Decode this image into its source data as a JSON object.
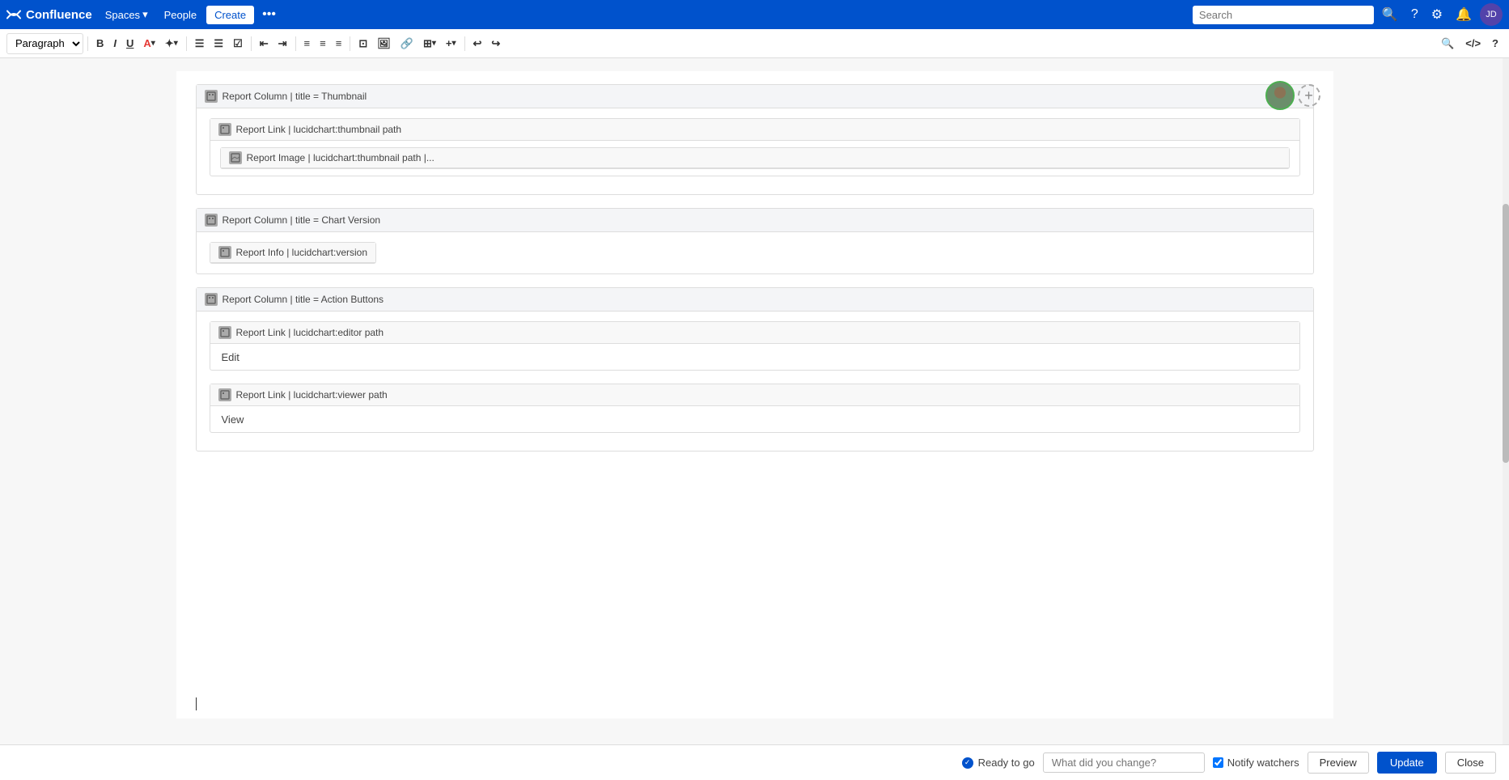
{
  "nav": {
    "logo_text": "Confluence",
    "spaces_label": "Spaces",
    "people_label": "People",
    "create_label": "Create",
    "search_placeholder": "Search",
    "help_icon": "?",
    "settings_icon": "⚙",
    "notifications_icon": "🔔"
  },
  "toolbar": {
    "paragraph_label": "Paragraph",
    "bold_label": "B",
    "italic_label": "I",
    "underline_label": "U",
    "color_label": "A",
    "format_label": "✦",
    "bullet_label": "≡",
    "numbered_label": "≡",
    "task_label": "☑",
    "indent_left_label": "←",
    "indent_right_label": "→",
    "align_left": "≡",
    "align_center": "≡",
    "align_right": "≡",
    "panel_label": "⊡",
    "image_label": "🖼",
    "link_label": "🔗",
    "table_label": "⊞",
    "insert_label": "+",
    "undo_label": "↩",
    "redo_label": "↪",
    "find_label": "🔍",
    "source_label": "</>",
    "help_label": "?"
  },
  "editor": {
    "columns": [
      {
        "id": "col-thumbnail",
        "header": "Report Column | title = Thumbnail",
        "children": [
          {
            "type": "link",
            "header": "Report Link | lucidchart:thumbnail path",
            "children": [
              {
                "type": "image",
                "header": "Report Image | lucidchart:thumbnail path |..."
              }
            ]
          }
        ]
      },
      {
        "id": "col-chart-version",
        "header": "Report Column | title = Chart Version",
        "children": [
          {
            "type": "info",
            "header": "Report Info | lucidchart:version"
          }
        ]
      },
      {
        "id": "col-action-buttons",
        "header": "Report Column | title = Action Buttons",
        "links": [
          {
            "header": "Report Link | lucidchart:editor path",
            "body_text": "Edit"
          },
          {
            "header": "Report Link | lucidchart:viewer path",
            "body_text": "View"
          }
        ]
      }
    ]
  },
  "bottom_bar": {
    "ready_label": "Ready to go",
    "change_placeholder": "What did you change?",
    "notify_label": "Notify watchers",
    "notify_checked": true,
    "preview_label": "Preview",
    "update_label": "Update",
    "close_label": "Close"
  }
}
